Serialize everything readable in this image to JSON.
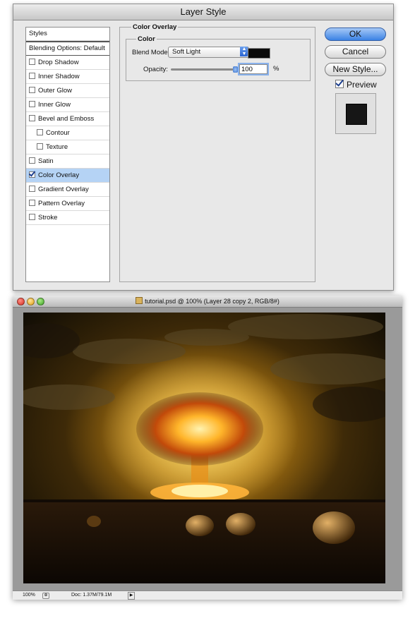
{
  "dialog": {
    "title": "Layer Style",
    "styles_header": "Styles",
    "blending_options": "Blending Options: Default",
    "styles": [
      {
        "label": "Drop Shadow",
        "checked": false,
        "indent": false
      },
      {
        "label": "Inner Shadow",
        "checked": false,
        "indent": false
      },
      {
        "label": "Outer Glow",
        "checked": false,
        "indent": false
      },
      {
        "label": "Inner Glow",
        "checked": false,
        "indent": false
      },
      {
        "label": "Bevel and Emboss",
        "checked": false,
        "indent": false
      },
      {
        "label": "Contour",
        "checked": false,
        "indent": true
      },
      {
        "label": "Texture",
        "checked": false,
        "indent": true
      },
      {
        "label": "Satin",
        "checked": false,
        "indent": false
      },
      {
        "label": "Color Overlay",
        "checked": true,
        "indent": false,
        "selected": true
      },
      {
        "label": "Gradient Overlay",
        "checked": false,
        "indent": false
      },
      {
        "label": "Pattern Overlay",
        "checked": false,
        "indent": false
      },
      {
        "label": "Stroke",
        "checked": false,
        "indent": false
      }
    ],
    "panel_title": "Color Overlay",
    "group_title": "Color",
    "blend_mode_label": "Blend Mode:",
    "blend_mode_value": "Soft Light",
    "overlay_color": "#0b0b0b",
    "opacity_label": "Opacity:",
    "opacity_value": "100",
    "opacity_unit": "%",
    "buttons": {
      "ok": "OK",
      "cancel": "Cancel",
      "new_style": "New Style..."
    },
    "preview_label": "Preview",
    "preview_checked": true
  },
  "document": {
    "title": "tutorial.psd @ 100% (Layer 28 copy 2, RGB/8#)",
    "zoom": "100%",
    "doc_size": "Doc: 1.37M/79.1M",
    "image_description_icon": "mushroom-cloud-explosion-scene"
  },
  "colors": {
    "accent": "#3b82e4",
    "selection": "#b5d3f5",
    "dialog_bg": "#e8e8e8"
  }
}
